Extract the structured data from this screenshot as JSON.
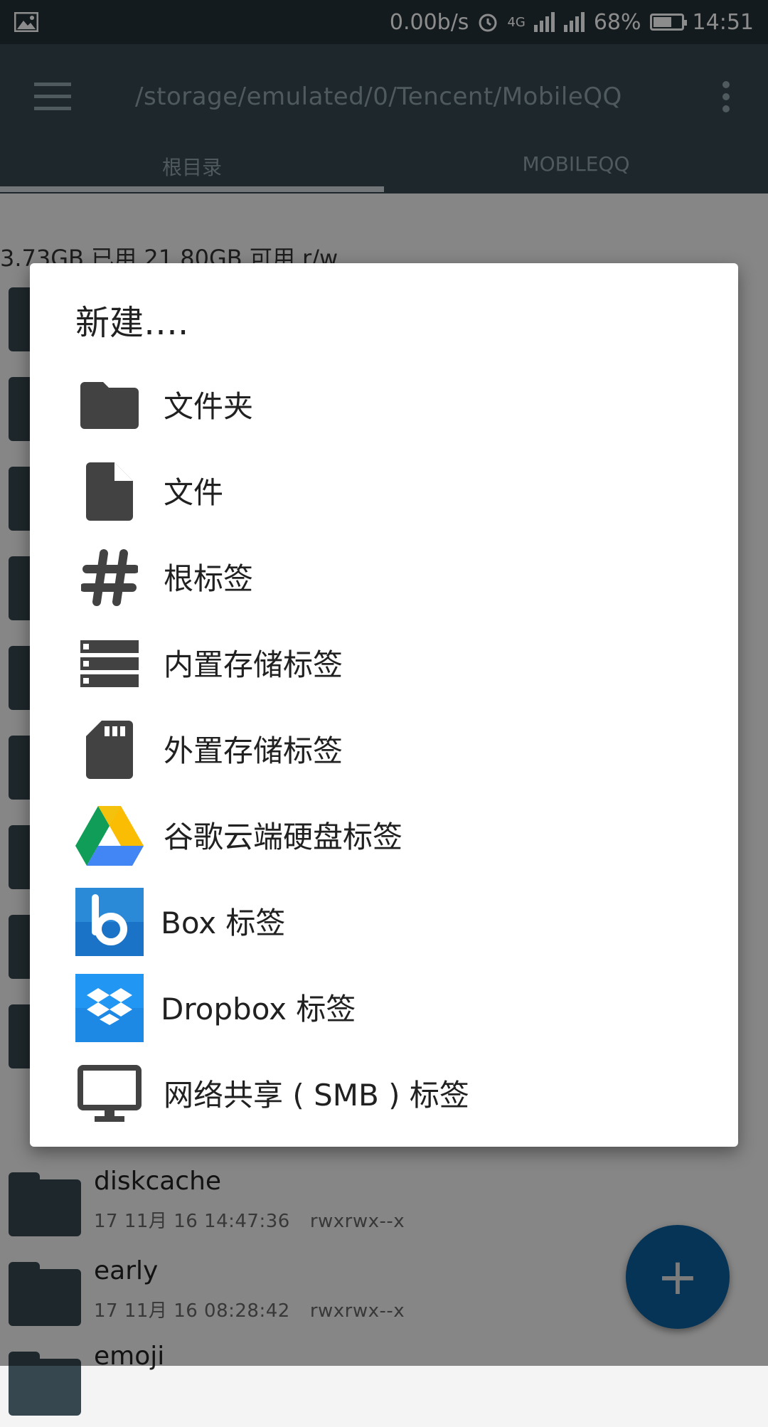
{
  "status_bar": {
    "network_speed": "0.00b/s",
    "network_type": "4G",
    "battery_percent": "68%",
    "time": "14:51",
    "icons": [
      "image-icon",
      "alarm-icon",
      "signal-icon",
      "signal-icon",
      "battery-icon"
    ]
  },
  "toolbar": {
    "path": "/storage/emulated/0/Tencent/MobileQQ",
    "tabs": [
      {
        "label": "根目录"
      },
      {
        "label": "MOBILEQQ"
      }
    ]
  },
  "storage": {
    "usage": "3.73GB 已用  21.80GB 可用  r/w"
  },
  "files": [
    {
      "name": "diskcache",
      "date": "17 11月 16 14:47:36",
      "perm": "rwxrwx--x"
    },
    {
      "name": "early",
      "date": "17 11月 16 08:28:42",
      "perm": "rwxrwx--x"
    },
    {
      "name": "emoji",
      "date": "",
      "perm": ""
    }
  ],
  "dialog": {
    "title": "新建….",
    "options": [
      {
        "label": "文件夹",
        "icon": "folder-icon"
      },
      {
        "label": "文件",
        "icon": "file-icon"
      },
      {
        "label": "根标签",
        "icon": "hash-icon"
      },
      {
        "label": "内置存储标签",
        "icon": "storage-icon"
      },
      {
        "label": "外置存储标签",
        "icon": "sd-card-icon"
      },
      {
        "label": "谷歌云端硬盘标签",
        "icon": "google-drive-icon"
      },
      {
        "label": "Box 标签",
        "icon": "box-icon"
      },
      {
        "label": "Dropbox 标签",
        "icon": "dropbox-icon"
      },
      {
        "label": "网络共享 ( SMB ) 标签",
        "icon": "monitor-icon"
      }
    ]
  },
  "fab": {
    "symbol": "+"
  },
  "colors": {
    "toolbar": "#37474f",
    "status_bar": "#263238",
    "fab": "#0a5f9e",
    "icon_dark": "#424242"
  }
}
